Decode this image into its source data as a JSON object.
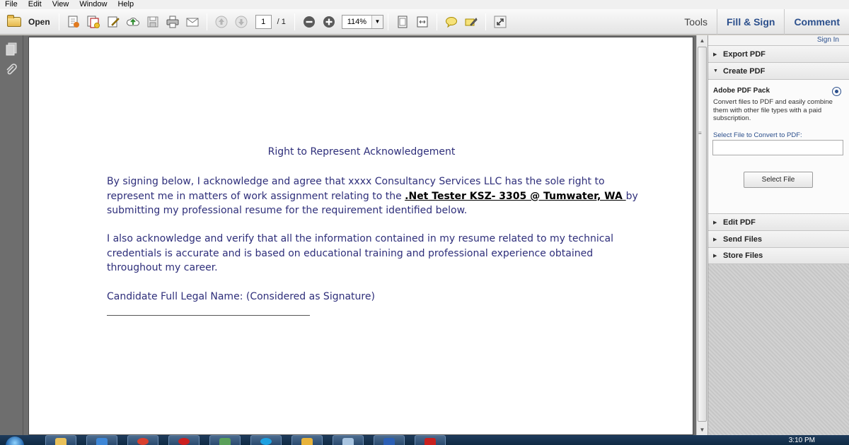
{
  "menu": [
    "File",
    "Edit",
    "View",
    "Window",
    "Help"
  ],
  "toolbar": {
    "open_label": "Open",
    "page_current": "1",
    "page_total": "/ 1",
    "zoom": "114%"
  },
  "right_tabs": {
    "tools": "Tools",
    "fill_sign": "Fill & Sign",
    "comment": "Comment"
  },
  "document": {
    "title": "Right to Represent Acknowledgement",
    "para1_before": "By signing below, I acknowledge and agree that xxxx Consultancy Services LLC has the sole right to represent me in matters of work assignment relating to the ",
    "para1_bold": ".Net Tester KSZ- 3305 @ Tumwater, WA ",
    "para1_after": "by submitting my professional resume for the requirement identified below.",
    "para2": "I also acknowledge and verify that all the information contained in my resume related to my technical credentials is accurate and is based on educational training and professional experience obtained throughout my career.",
    "para3": "Candidate Full Legal Name: (Considered as Signature)"
  },
  "panel": {
    "sign_in": "Sign In",
    "export_pdf": "Export PDF",
    "create_pdf": "Create PDF",
    "pack_title": "Adobe PDF Pack",
    "pack_desc": "Convert files to PDF and easily combine them with other file types with a paid subscription.",
    "select_label": "Select File to Convert to PDF:",
    "select_button": "Select File",
    "edit_pdf": "Edit PDF",
    "send_files": "Send Files",
    "store_files": "Store Files"
  },
  "taskbar": {
    "clock": "3:10 PM"
  },
  "colors": {
    "doc_text": "#2e2e7a",
    "accent": "#2b4f8c"
  }
}
